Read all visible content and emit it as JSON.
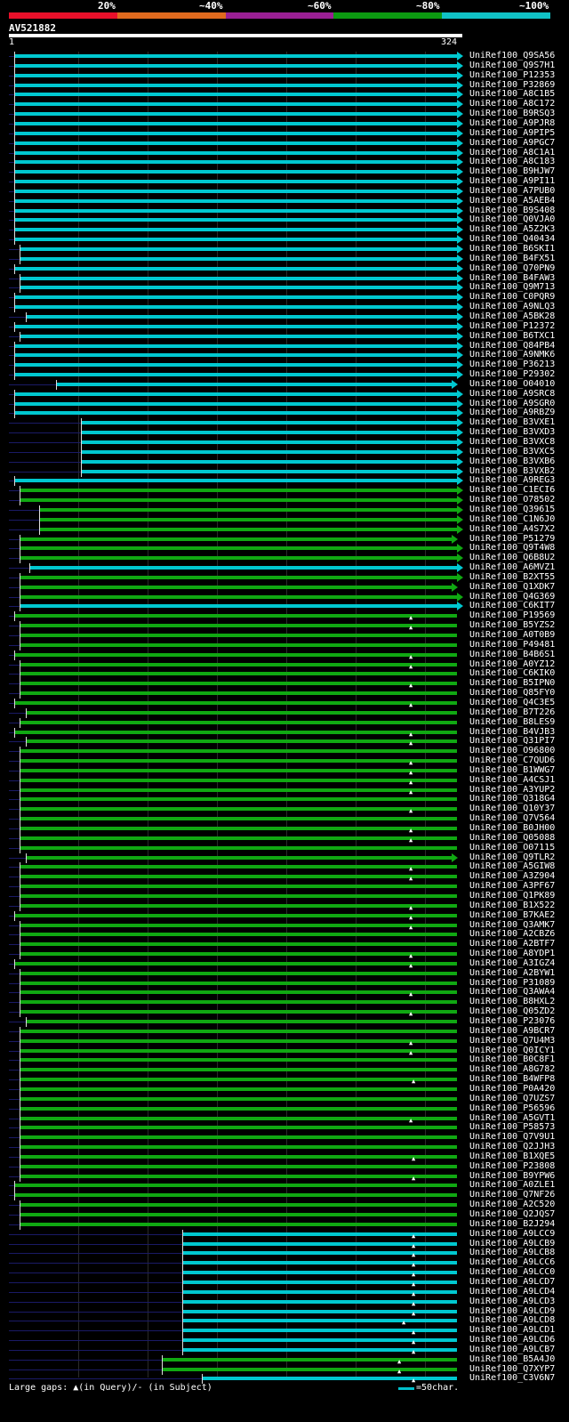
{
  "legend": {
    "labels": [
      "20%",
      "~40%",
      "~60%",
      "~80%",
      "~100%"
    ],
    "colors": [
      "#e8102a",
      "#e06a1e",
      "#9a1f94",
      "#0c9a11",
      "#10c2c6"
    ]
  },
  "query": {
    "name": "AV521882",
    "start": "1",
    "end": "324"
  },
  "footer": {
    "gaps_label": "Large gaps: ▲(in Query)/- (in Subject)",
    "scale_label": "=50char."
  },
  "hit_colors": {
    "cyan": "#00c8d0",
    "green": "#10a812"
  },
  "hits": [
    {
      "id": "UniRef100_Q9SA56",
      "color": "cyan",
      "start": 5,
      "end": 324,
      "arrow": true
    },
    {
      "id": "UniRef100_Q9S7H1",
      "color": "cyan",
      "start": 5,
      "end": 324,
      "arrow": true
    },
    {
      "id": "UniRef100_P12353",
      "color": "cyan",
      "start": 5,
      "end": 324,
      "arrow": true
    },
    {
      "id": "UniRef100_P32869",
      "color": "cyan",
      "start": 5,
      "end": 324,
      "arrow": true
    },
    {
      "id": "UniRef100_A8C1B5",
      "color": "cyan",
      "start": 5,
      "end": 324,
      "arrow": true
    },
    {
      "id": "UniRef100_A8C172",
      "color": "cyan",
      "start": 5,
      "end": 324,
      "arrow": true
    },
    {
      "id": "UniRef100_B9RSQ3",
      "color": "cyan",
      "start": 5,
      "end": 324,
      "arrow": true
    },
    {
      "id": "UniRef100_A9PJR8",
      "color": "cyan",
      "start": 5,
      "end": 324,
      "arrow": true
    },
    {
      "id": "UniRef100_A9PIP5",
      "color": "cyan",
      "start": 5,
      "end": 324,
      "arrow": true
    },
    {
      "id": "UniRef100_A9PGC7",
      "color": "cyan",
      "start": 5,
      "end": 324,
      "arrow": true
    },
    {
      "id": "UniRef100_A8C1A1",
      "color": "cyan",
      "start": 5,
      "end": 324,
      "arrow": true
    },
    {
      "id": "UniRef100_A8C183",
      "color": "cyan",
      "start": 5,
      "end": 324,
      "arrow": true
    },
    {
      "id": "UniRef100_B9HJW7",
      "color": "cyan",
      "start": 5,
      "end": 324,
      "arrow": true
    },
    {
      "id": "UniRef100_A9PI11",
      "color": "cyan",
      "start": 5,
      "end": 324,
      "arrow": true
    },
    {
      "id": "UniRef100_A7PUB0",
      "color": "cyan",
      "start": 5,
      "end": 324,
      "arrow": true
    },
    {
      "id": "UniRef100_A5AEB4",
      "color": "cyan",
      "start": 5,
      "end": 324,
      "arrow": true
    },
    {
      "id": "UniRef100_B9S408",
      "color": "cyan",
      "start": 5,
      "end": 324,
      "arrow": true
    },
    {
      "id": "UniRef100_Q0VJA0",
      "color": "cyan",
      "start": 5,
      "end": 324,
      "arrow": true
    },
    {
      "id": "UniRef100_A5Z2K3",
      "color": "cyan",
      "start": 5,
      "end": 324,
      "arrow": true
    },
    {
      "id": "UniRef100_Q40434",
      "color": "cyan",
      "start": 5,
      "end": 324,
      "arrow": true
    },
    {
      "id": "UniRef100_B6SKI1",
      "color": "cyan",
      "start": 9,
      "end": 324,
      "arrow": true
    },
    {
      "id": "UniRef100_B4FX51",
      "color": "cyan",
      "start": 9,
      "end": 324,
      "arrow": true
    },
    {
      "id": "UniRef100_Q70PN9",
      "color": "cyan",
      "start": 5,
      "end": 324,
      "arrow": true
    },
    {
      "id": "UniRef100_B4FAW3",
      "color": "cyan",
      "start": 9,
      "end": 324,
      "arrow": true
    },
    {
      "id": "UniRef100_Q9M713",
      "color": "cyan",
      "start": 9,
      "end": 324,
      "arrow": true
    },
    {
      "id": "UniRef100_C0PQR9",
      "color": "cyan",
      "start": 5,
      "end": 324,
      "arrow": true
    },
    {
      "id": "UniRef100_A9NLQ3",
      "color": "cyan",
      "start": 5,
      "end": 324,
      "arrow": true
    },
    {
      "id": "UniRef100_A5BK28",
      "color": "cyan",
      "start": 13,
      "end": 324,
      "arrow": true
    },
    {
      "id": "UniRef100_P12372",
      "color": "cyan",
      "start": 5,
      "end": 324,
      "arrow": true
    },
    {
      "id": "UniRef100_B6TXC1",
      "color": "cyan",
      "start": 9,
      "end": 324,
      "arrow": true
    },
    {
      "id": "UniRef100_Q84PB4",
      "color": "cyan",
      "start": 5,
      "end": 324,
      "arrow": true
    },
    {
      "id": "UniRef100_A9NMK6",
      "color": "cyan",
      "start": 5,
      "end": 324,
      "arrow": true
    },
    {
      "id": "UniRef100_P36213",
      "color": "cyan",
      "start": 5,
      "end": 324,
      "arrow": true
    },
    {
      "id": "UniRef100_P29302",
      "color": "cyan",
      "start": 5,
      "end": 324,
      "arrow": true
    },
    {
      "id": "UniRef100_O04010",
      "color": "cyan",
      "start": 35,
      "end": 320,
      "arrow": true
    },
    {
      "id": "UniRef100_A9SRC8",
      "color": "cyan",
      "start": 5,
      "end": 324,
      "arrow": true
    },
    {
      "id": "UniRef100_A9SGR0",
      "color": "cyan",
      "start": 5,
      "end": 324,
      "arrow": true
    },
    {
      "id": "UniRef100_A9RBZ9",
      "color": "cyan",
      "start": 5,
      "end": 324,
      "arrow": true
    },
    {
      "id": "UniRef100_B3VXE1",
      "color": "cyan",
      "start": 53,
      "end": 324,
      "arrow": true
    },
    {
      "id": "UniRef100_B3VXD3",
      "color": "cyan",
      "start": 53,
      "end": 324,
      "arrow": true
    },
    {
      "id": "UniRef100_B3VXC8",
      "color": "cyan",
      "start": 53,
      "end": 324,
      "arrow": true
    },
    {
      "id": "UniRef100_B3VXC5",
      "color": "cyan",
      "start": 53,
      "end": 324,
      "arrow": true
    },
    {
      "id": "UniRef100_B3VXB6",
      "color": "cyan",
      "start": 53,
      "end": 324,
      "arrow": true
    },
    {
      "id": "UniRef100_B3VXB2",
      "color": "cyan",
      "start": 53,
      "end": 324,
      "arrow": true
    },
    {
      "id": "UniRef100_A9REG3",
      "color": "cyan",
      "start": 5,
      "end": 324,
      "arrow": true
    },
    {
      "id": "UniRef100_C1ECI6",
      "color": "green",
      "start": 9,
      "end": 324,
      "arrow": true
    },
    {
      "id": "UniRef100_O78502",
      "color": "green",
      "start": 9,
      "end": 324,
      "arrow": true
    },
    {
      "id": "UniRef100_Q39615",
      "color": "green",
      "start": 23,
      "end": 324,
      "arrow": true
    },
    {
      "id": "UniRef100_C1N6J0",
      "color": "green",
      "start": 23,
      "end": 324,
      "arrow": true
    },
    {
      "id": "UniRef100_A4S7X2",
      "color": "green",
      "start": 23,
      "end": 324,
      "arrow": true
    },
    {
      "id": "UniRef100_P51279",
      "color": "green",
      "start": 9,
      "end": 320,
      "arrow": true
    },
    {
      "id": "UniRef100_Q9T4W8",
      "color": "green",
      "start": 9,
      "end": 324,
      "arrow": true
    },
    {
      "id": "UniRef100_Q6B8U2",
      "color": "green",
      "start": 9,
      "end": 324,
      "arrow": true
    },
    {
      "id": "UniRef100_A6MVZ1",
      "color": "cyan",
      "start": 16,
      "end": 324,
      "arrow": true
    },
    {
      "id": "UniRef100_B2XT55",
      "color": "green",
      "start": 9,
      "end": 324,
      "arrow": true
    },
    {
      "id": "UniRef100_Q1XDK7",
      "color": "green",
      "start": 9,
      "end": 320,
      "arrow": true
    },
    {
      "id": "UniRef100_Q4G369",
      "color": "green",
      "start": 9,
      "end": 324,
      "arrow": true
    },
    {
      "id": "UniRef100_C6KIT7",
      "color": "cyan",
      "start": 9,
      "end": 324,
      "arrow": true
    },
    {
      "id": "UniRef100_P19569",
      "color": "green",
      "start": 5,
      "end": 324,
      "arrow": false,
      "gap": 291
    },
    {
      "id": "UniRef100_B5YZS2",
      "color": "green",
      "start": 9,
      "end": 324,
      "arrow": false,
      "gap": 291
    },
    {
      "id": "UniRef100_A0T0B9",
      "color": "green",
      "start": 9,
      "end": 324,
      "arrow": false
    },
    {
      "id": "UniRef100_P49481",
      "color": "green",
      "start": 9,
      "end": 324,
      "arrow": false
    },
    {
      "id": "UniRef100_B4B6S1",
      "color": "green",
      "start": 5,
      "end": 324,
      "arrow": false,
      "gap": 291
    },
    {
      "id": "UniRef100_A0YZ12",
      "color": "green",
      "start": 9,
      "end": 324,
      "arrow": false,
      "gap": 291
    },
    {
      "id": "UniRef100_C6KIK0",
      "color": "green",
      "start": 9,
      "end": 324,
      "arrow": false
    },
    {
      "id": "UniRef100_B5IPN0",
      "color": "green",
      "start": 9,
      "end": 324,
      "arrow": false,
      "gap": 291
    },
    {
      "id": "UniRef100_Q85FY0",
      "color": "green",
      "start": 9,
      "end": 324,
      "arrow": false
    },
    {
      "id": "UniRef100_Q4C3E5",
      "color": "green",
      "start": 5,
      "end": 324,
      "arrow": false,
      "gap": 291
    },
    {
      "id": "UniRef100_B7T226",
      "color": "green",
      "start": 13,
      "end": 324,
      "arrow": false
    },
    {
      "id": "UniRef100_B8LES9",
      "color": "green",
      "start": 9,
      "end": 324,
      "arrow": false
    },
    {
      "id": "UniRef100_B4VJB3",
      "color": "green",
      "start": 5,
      "end": 324,
      "arrow": false,
      "gap": 291
    },
    {
      "id": "UniRef100_Q31PI7",
      "color": "green",
      "start": 13,
      "end": 324,
      "arrow": false,
      "gap": 291
    },
    {
      "id": "UniRef100_O96800",
      "color": "green",
      "start": 9,
      "end": 324,
      "arrow": false
    },
    {
      "id": "UniRef100_C7QUD6",
      "color": "green",
      "start": 9,
      "end": 324,
      "arrow": false,
      "gap": 291
    },
    {
      "id": "UniRef100_B1WWG7",
      "color": "green",
      "start": 9,
      "end": 324,
      "arrow": false,
      "gap": 291
    },
    {
      "id": "UniRef100_A4CSJ1",
      "color": "green",
      "start": 9,
      "end": 324,
      "arrow": false,
      "gap": 291
    },
    {
      "id": "UniRef100_A3YUP2",
      "color": "green",
      "start": 9,
      "end": 324,
      "arrow": false,
      "gap": 291
    },
    {
      "id": "UniRef100_Q318G4",
      "color": "green",
      "start": 9,
      "end": 324,
      "arrow": false
    },
    {
      "id": "UniRef100_Q10Y37",
      "color": "green",
      "start": 9,
      "end": 324,
      "arrow": false,
      "gap": 291
    },
    {
      "id": "UniRef100_Q7V564",
      "color": "green",
      "start": 9,
      "end": 324,
      "arrow": false
    },
    {
      "id": "UniRef100_B0JH00",
      "color": "green",
      "start": 9,
      "end": 324,
      "arrow": false,
      "gap": 291
    },
    {
      "id": "UniRef100_Q05088",
      "color": "green",
      "start": 9,
      "end": 324,
      "arrow": false,
      "gap": 291
    },
    {
      "id": "UniRef100_O07115",
      "color": "green",
      "start": 9,
      "end": 324,
      "arrow": false
    },
    {
      "id": "UniRef100_Q9TLR2",
      "color": "green",
      "start": 13,
      "end": 320,
      "arrow": true
    },
    {
      "id": "UniRef100_A5GIW8",
      "color": "green",
      "start": 9,
      "end": 324,
      "arrow": false,
      "gap": 291
    },
    {
      "id": "UniRef100_A3Z904",
      "color": "green",
      "start": 9,
      "end": 324,
      "arrow": false,
      "gap": 291
    },
    {
      "id": "UniRef100_A3PF67",
      "color": "green",
      "start": 9,
      "end": 324,
      "arrow": false
    },
    {
      "id": "UniRef100_Q1PK89",
      "color": "green",
      "start": 9,
      "end": 324,
      "arrow": false
    },
    {
      "id": "UniRef100_B1X522",
      "color": "green",
      "start": 9,
      "end": 324,
      "arrow": false,
      "gap": 291
    },
    {
      "id": "UniRef100_B7KAE2",
      "color": "green",
      "start": 5,
      "end": 324,
      "arrow": false,
      "gap": 291
    },
    {
      "id": "UniRef100_Q3AMK7",
      "color": "green",
      "start": 9,
      "end": 324,
      "arrow": false,
      "gap": 291
    },
    {
      "id": "UniRef100_A2CBZ6",
      "color": "green",
      "start": 9,
      "end": 324,
      "arrow": false
    },
    {
      "id": "UniRef100_A2BTF7",
      "color": "green",
      "start": 9,
      "end": 324,
      "arrow": false
    },
    {
      "id": "UniRef100_A8YDP1",
      "color": "green",
      "start": 9,
      "end": 324,
      "arrow": false,
      "gap": 291
    },
    {
      "id": "UniRef100_A3IGZ4",
      "color": "green",
      "start": 5,
      "end": 324,
      "arrow": false,
      "gap": 291
    },
    {
      "id": "UniRef100_A2BYW1",
      "color": "green",
      "start": 9,
      "end": 324,
      "arrow": false
    },
    {
      "id": "UniRef100_P31089",
      "color": "green",
      "start": 9,
      "end": 324,
      "arrow": false
    },
    {
      "id": "UniRef100_Q3AWA4",
      "color": "green",
      "start": 9,
      "end": 324,
      "arrow": false,
      "gap": 291
    },
    {
      "id": "UniRef100_B8HXL2",
      "color": "green",
      "start": 9,
      "end": 324,
      "arrow": false
    },
    {
      "id": "UniRef100_Q05ZD2",
      "color": "green",
      "start": 9,
      "end": 324,
      "arrow": false,
      "gap": 291
    },
    {
      "id": "UniRef100_P23076",
      "color": "green",
      "start": 13,
      "end": 324,
      "arrow": false
    },
    {
      "id": "UniRef100_A9BCR7",
      "color": "green",
      "start": 9,
      "end": 324,
      "arrow": false
    },
    {
      "id": "UniRef100_Q7U4M3",
      "color": "green",
      "start": 9,
      "end": 324,
      "arrow": false,
      "gap": 291
    },
    {
      "id": "UniRef100_Q0ICY1",
      "color": "green",
      "start": 9,
      "end": 324,
      "arrow": false,
      "gap": 291
    },
    {
      "id": "UniRef100_B0C8F1",
      "color": "green",
      "start": 9,
      "end": 324,
      "arrow": false
    },
    {
      "id": "UniRef100_A8G782",
      "color": "green",
      "start": 9,
      "end": 324,
      "arrow": false
    },
    {
      "id": "UniRef100_B4WFP8",
      "color": "green",
      "start": 9,
      "end": 324,
      "arrow": false,
      "gap": 293
    },
    {
      "id": "UniRef100_P0A420",
      "color": "green",
      "start": 9,
      "end": 324,
      "arrow": false
    },
    {
      "id": "UniRef100_Q7UZS7",
      "color": "green",
      "start": 9,
      "end": 324,
      "arrow": false
    },
    {
      "id": "UniRef100_P56596",
      "color": "green",
      "start": 9,
      "end": 324,
      "arrow": false
    },
    {
      "id": "UniRef100_A5GVT1",
      "color": "green",
      "start": 9,
      "end": 324,
      "arrow": false,
      "gap": 291
    },
    {
      "id": "UniRef100_P58573",
      "color": "green",
      "start": 9,
      "end": 324,
      "arrow": false
    },
    {
      "id": "UniRef100_Q7V9U1",
      "color": "green",
      "start": 9,
      "end": 324,
      "arrow": false
    },
    {
      "id": "UniRef100_Q2JJH3",
      "color": "green",
      "start": 9,
      "end": 324,
      "arrow": false
    },
    {
      "id": "UniRef100_B1XQE5",
      "color": "green",
      "start": 9,
      "end": 324,
      "arrow": false,
      "gap": 293
    },
    {
      "id": "UniRef100_P23808",
      "color": "green",
      "start": 9,
      "end": 324,
      "arrow": false
    },
    {
      "id": "UniRef100_B9YPW6",
      "color": "green",
      "start": 9,
      "end": 324,
      "arrow": false,
      "gap": 293
    },
    {
      "id": "UniRef100_A0ZLE1",
      "color": "green",
      "start": 5,
      "end": 324,
      "arrow": false
    },
    {
      "id": "UniRef100_Q7NF26",
      "color": "green",
      "start": 5,
      "end": 324,
      "arrow": false
    },
    {
      "id": "UniRef100_A2C520",
      "color": "green",
      "start": 9,
      "end": 324,
      "arrow": false
    },
    {
      "id": "UniRef100_Q2JQS7",
      "color": "green",
      "start": 9,
      "end": 324,
      "arrow": false
    },
    {
      "id": "UniRef100_B2J294",
      "color": "green",
      "start": 9,
      "end": 324,
      "arrow": false
    },
    {
      "id": "UniRef100_A9LCC9",
      "color": "cyan",
      "start": 126,
      "end": 324,
      "arrow": false,
      "gap": 293
    },
    {
      "id": "UniRef100_A9LCB9",
      "color": "cyan",
      "start": 126,
      "end": 324,
      "arrow": false,
      "gap": 293
    },
    {
      "id": "UniRef100_A9LCB8",
      "color": "cyan",
      "start": 126,
      "end": 324,
      "arrow": false,
      "gap": 293
    },
    {
      "id": "UniRef100_A9LCC6",
      "color": "cyan",
      "start": 126,
      "end": 324,
      "arrow": false,
      "gap": 293
    },
    {
      "id": "UniRef100_A9LCC0",
      "color": "cyan",
      "start": 126,
      "end": 324,
      "arrow": false,
      "gap": 293
    },
    {
      "id": "UniRef100_A9LCD7",
      "color": "cyan",
      "start": 126,
      "end": 324,
      "arrow": false,
      "gap": 293
    },
    {
      "id": "UniRef100_A9LCD4",
      "color": "cyan",
      "start": 126,
      "end": 324,
      "arrow": false,
      "gap": 293
    },
    {
      "id": "UniRef100_A9LCD3",
      "color": "cyan",
      "start": 126,
      "end": 324,
      "arrow": false,
      "gap": 293
    },
    {
      "id": "UniRef100_A9LCD9",
      "color": "cyan",
      "start": 126,
      "end": 324,
      "arrow": false,
      "gap": 293
    },
    {
      "id": "UniRef100_A9LCD8",
      "color": "cyan",
      "start": 126,
      "end": 324,
      "arrow": false,
      "gap": 286
    },
    {
      "id": "UniRef100_A9LCD1",
      "color": "cyan",
      "start": 126,
      "end": 324,
      "arrow": false,
      "gap": 293
    },
    {
      "id": "UniRef100_A9LCD6",
      "color": "cyan",
      "start": 126,
      "end": 324,
      "arrow": false,
      "gap": 293
    },
    {
      "id": "UniRef100_A9LCB7",
      "color": "cyan",
      "start": 126,
      "end": 324,
      "arrow": false,
      "gap": 293
    },
    {
      "id": "UniRef100_B5A4J0",
      "color": "green",
      "start": 111,
      "end": 324,
      "arrow": false,
      "gap": 283
    },
    {
      "id": "UniRef100_Q7XYP7",
      "color": "green",
      "start": 111,
      "end": 324,
      "arrow": false,
      "gap": 283
    },
    {
      "id": "UniRef100_C3V6N7",
      "color": "cyan",
      "start": 140,
      "end": 324,
      "arrow": false,
      "gap": 293
    }
  ]
}
